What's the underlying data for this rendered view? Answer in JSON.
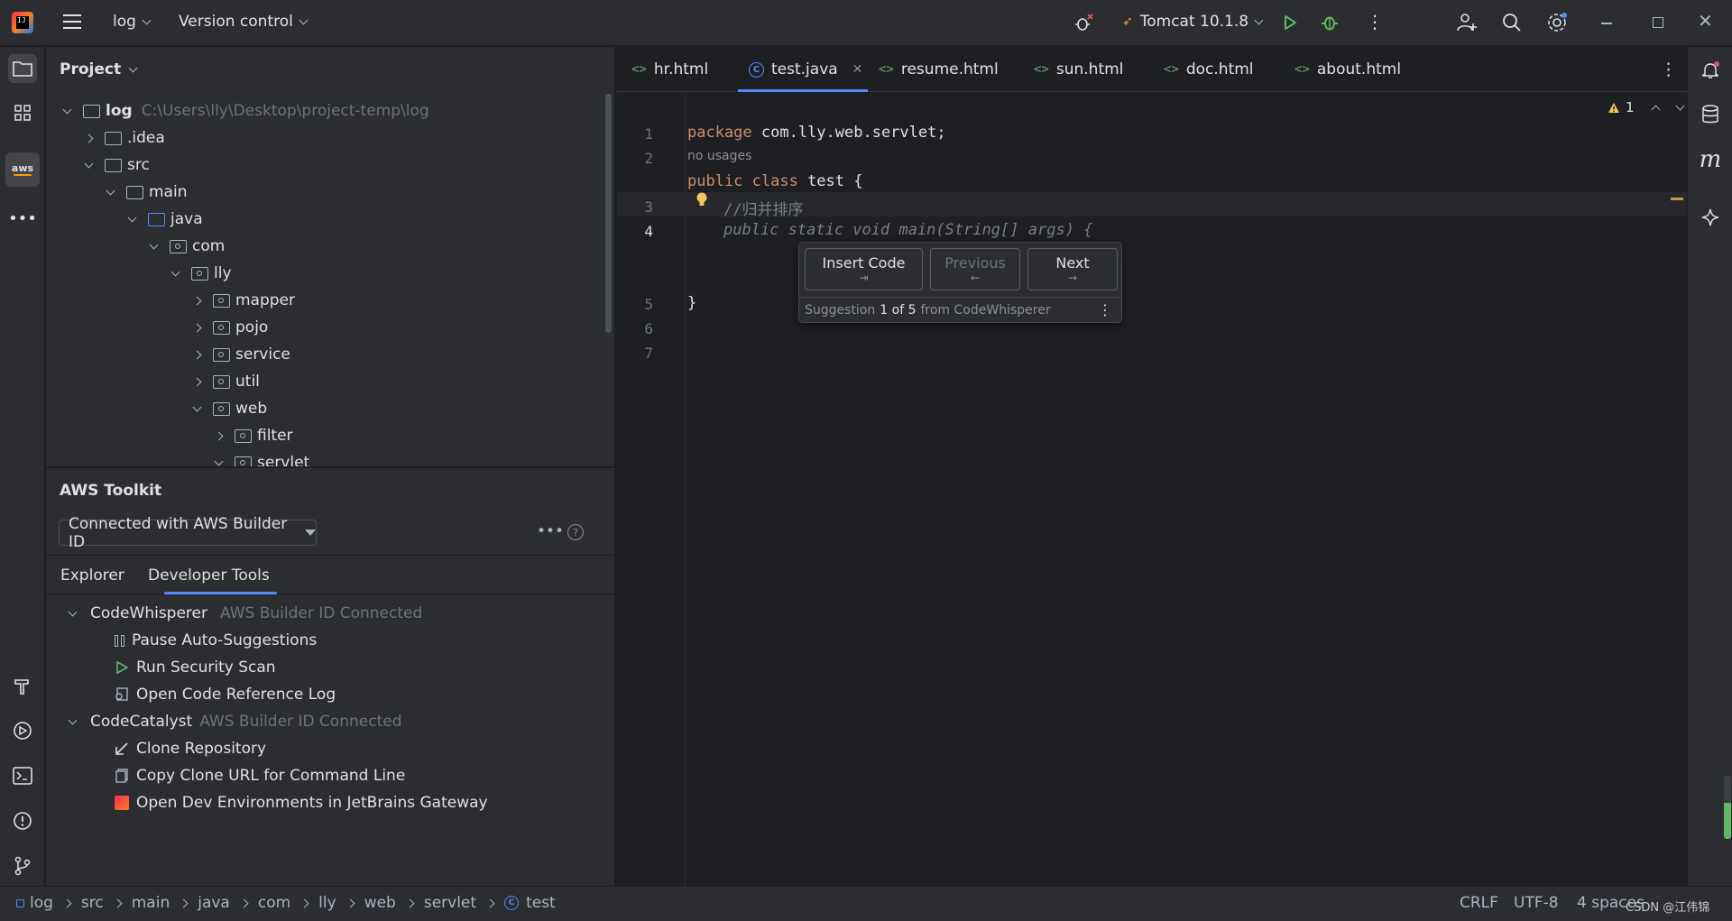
{
  "titlebar": {
    "project": "log",
    "vcs": "Version control",
    "run_config": "Tomcat 10.1.8"
  },
  "project_panel": {
    "title": "Project",
    "tree": [
      {
        "label": "log",
        "path": "C:\\Users\\lly\\Desktop\\project-temp\\log",
        "expanded": true
      },
      {
        "label": ".idea",
        "expanded": false
      },
      {
        "label": "src",
        "expanded": true
      },
      {
        "label": "main",
        "expanded": true
      },
      {
        "label": "java",
        "expanded": true
      },
      {
        "label": "com",
        "expanded": true
      },
      {
        "label": "lly",
        "expanded": true
      },
      {
        "label": "mapper",
        "expanded": false
      },
      {
        "label": "pojo",
        "expanded": false
      },
      {
        "label": "service",
        "expanded": false
      },
      {
        "label": "util",
        "expanded": false
      },
      {
        "label": "web",
        "expanded": true
      },
      {
        "label": "filter",
        "expanded": false
      },
      {
        "label": "servlet",
        "expanded": true
      }
    ]
  },
  "aws": {
    "title": "AWS Toolkit",
    "connection": "Connected with AWS Builder ID",
    "tabs": [
      "Explorer",
      "Developer Tools"
    ],
    "active_tab": "Developer Tools",
    "codewhisperer": {
      "label": "CodeWhisperer",
      "status": "AWS Builder ID Connected"
    },
    "cw_items": [
      "Pause Auto-Suggestions",
      "Run Security Scan",
      "Open Code Reference Log"
    ],
    "codecatalyst": {
      "label": "CodeCatalyst",
      "status": "AWS Builder ID Connected"
    },
    "cc_items": [
      "Clone Repository",
      "Copy Clone URL for Command Line",
      "Open Dev Environments in JetBrains Gateway"
    ]
  },
  "editor": {
    "tabs": [
      "hr.html",
      "test.java",
      "resume.html",
      "sun.html",
      "doc.html",
      "about.html"
    ],
    "active_tab": "test.java",
    "warnings": "1",
    "line_numbers": [
      "1",
      "2",
      "3",
      "4",
      "5",
      "6",
      "7"
    ],
    "code": {
      "l1_kw": "package",
      "l1_rest": " com.lly.web.servlet;",
      "usages": "no usages",
      "l3_kw": "public class",
      "l3_rest": " test {",
      "l4": "//归并排序",
      "l5": "public static void main(String[] args) {",
      "l7": "}"
    }
  },
  "suggestion_popup": {
    "insert": "Insert Code",
    "insert_key": "⇥",
    "previous": "Previous",
    "previous_key": "←",
    "next": "Next",
    "next_key": "→",
    "footer_prefix": "Suggestion",
    "footer_index": "1 of 5",
    "footer_suffix": "from CodeWhisperer"
  },
  "statusbar": {
    "breadcrumbs": [
      "log",
      "src",
      "main",
      "java",
      "com",
      "lly",
      "web",
      "servlet",
      "test"
    ],
    "line_sep": "CRLF",
    "encoding": "UTF-8",
    "indent": "4 spaces",
    "watermark": "CSDN @江伟锦"
  },
  "colors": {
    "accent": "#548af7",
    "bg": "#1e1f22",
    "panel": "#2b2d30",
    "keyword": "#cf8e6d",
    "run": "#5fb865"
  }
}
